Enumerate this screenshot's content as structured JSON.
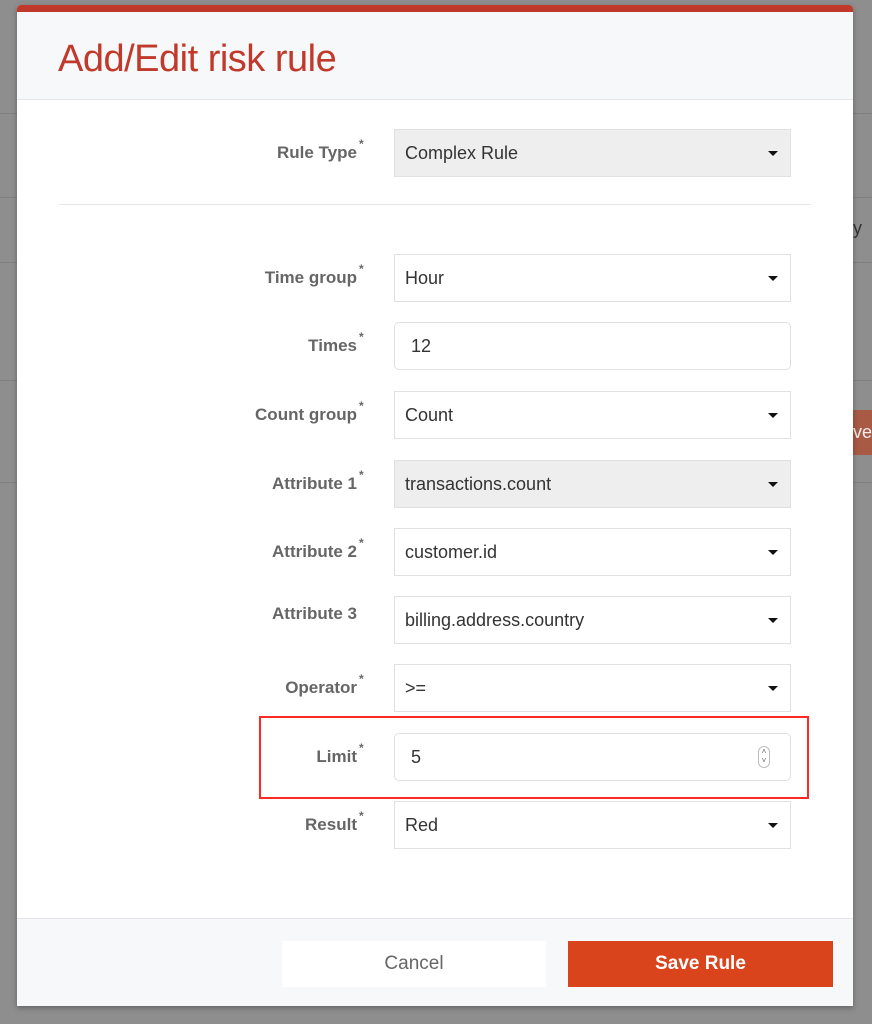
{
  "background": {
    "partial_text": "y",
    "partial_button": "ve"
  },
  "modal": {
    "title": "Add/Edit risk rule",
    "required_marker": "*",
    "fields": [
      {
        "label": "Rule Type",
        "value": "Complex Rule",
        "type": "select",
        "required": true,
        "disabled": true
      },
      {
        "label": "Time group",
        "value": "Hour",
        "type": "select",
        "required": true
      },
      {
        "label": "Times",
        "value": "12",
        "type": "text",
        "required": true
      },
      {
        "label": "Count group",
        "value": "Count",
        "type": "select",
        "required": true
      },
      {
        "label": "Attribute 1",
        "value": "transactions.count",
        "type": "select",
        "required": true,
        "disabled": true
      },
      {
        "label": "Attribute 2",
        "value": "customer.id",
        "type": "select",
        "required": true
      },
      {
        "label": "Attribute 3",
        "value": "billing.address.country",
        "type": "select",
        "required": false
      },
      {
        "label": "Operator",
        "value": ">=",
        "type": "select",
        "required": true
      },
      {
        "label": "Limit",
        "value": "5",
        "type": "number",
        "required": true,
        "highlighted": true
      },
      {
        "label": "Result",
        "value": "Red",
        "type": "select",
        "required": true
      }
    ],
    "cancel_label": "Cancel",
    "save_label": "Save Rule"
  },
  "colors": {
    "accent": "#c0392b",
    "save_button": "#d9441d",
    "highlight": "#ff2a24"
  }
}
